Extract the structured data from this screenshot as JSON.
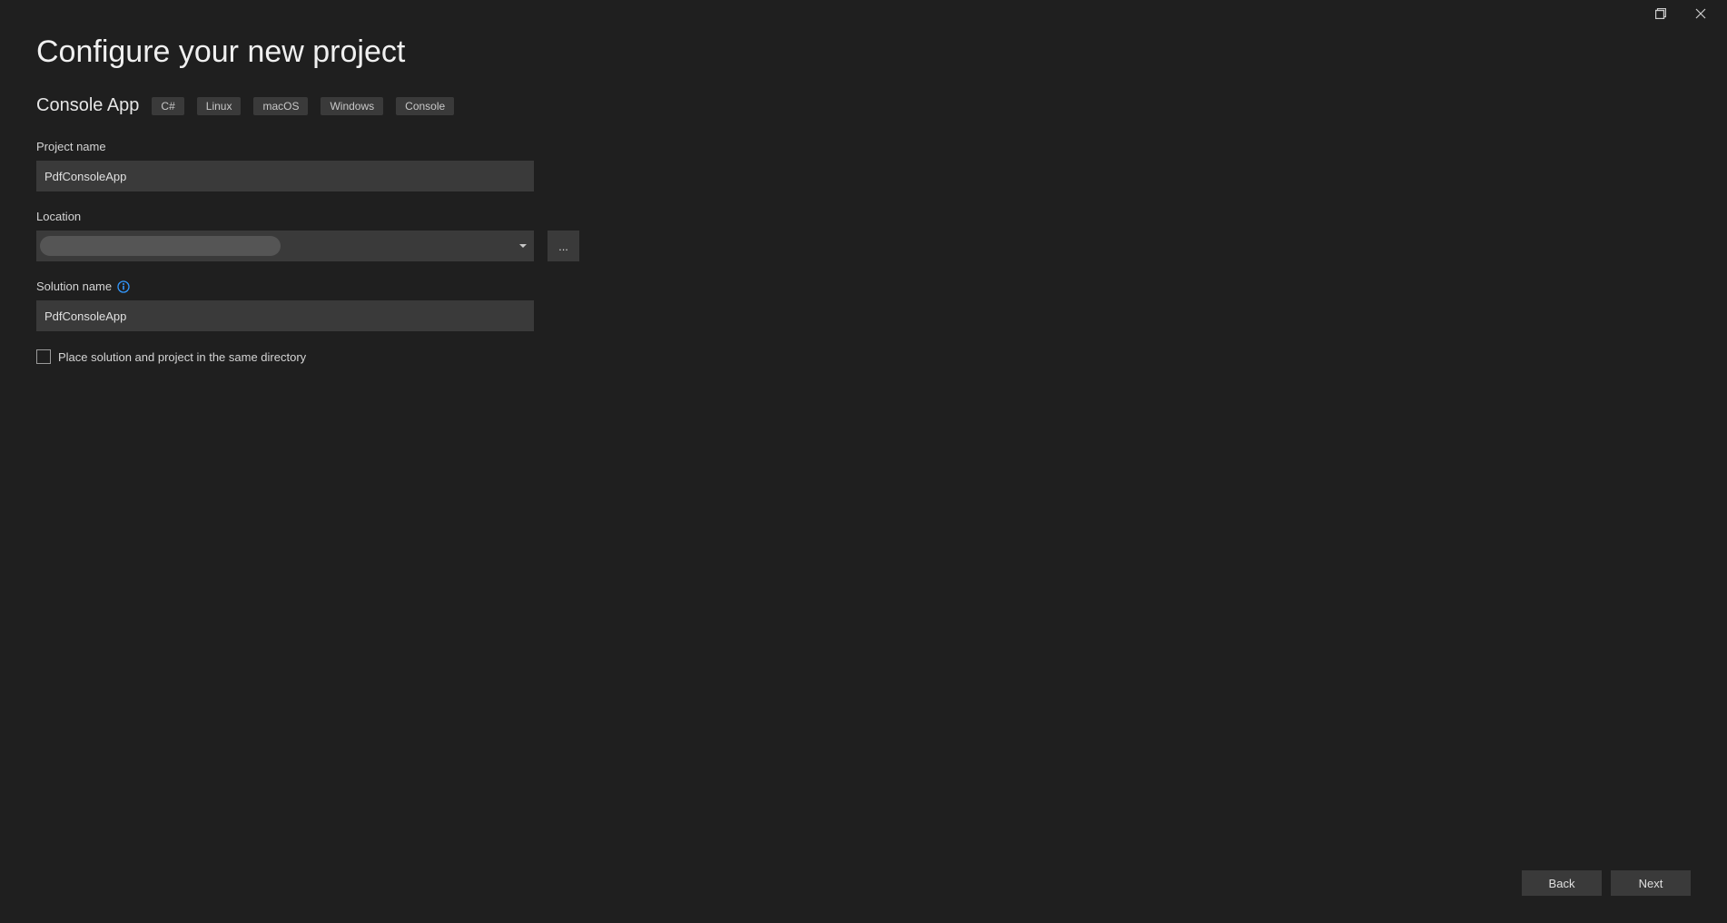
{
  "window": {
    "title": "Configure your new project"
  },
  "template": {
    "name": "Console App",
    "tags": [
      "C#",
      "Linux",
      "macOS",
      "Windows",
      "Console"
    ]
  },
  "fields": {
    "project_name": {
      "label": "Project name",
      "value": "PdfConsoleApp"
    },
    "location": {
      "label": "Location",
      "value": "",
      "browse_label": "..."
    },
    "solution_name": {
      "label": "Solution name",
      "value": "PdfConsoleApp"
    },
    "same_directory": {
      "label": "Place solution and project in the same directory",
      "checked": false
    }
  },
  "footer": {
    "back_label": "Back",
    "next_label": "Next"
  },
  "icons": {
    "info": "info-icon",
    "maximize": "maximize-icon",
    "close": "close-icon",
    "caret": "chevron-down-icon"
  }
}
